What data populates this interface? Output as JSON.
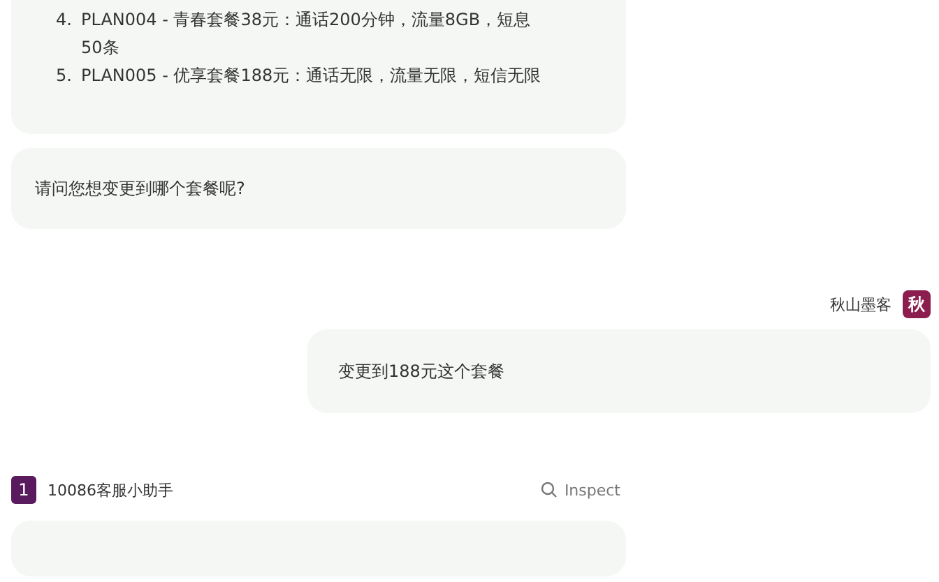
{
  "messages": [
    {
      "kind": "list",
      "items": [
        {
          "number": "4.",
          "text": "PLAN004 - 青春套餐38元：通话200分钟，流量8GB，短息50条"
        },
        {
          "number": "5.",
          "text": "PLAN005 - 优享套餐188元：通话无限，流量无限，短信无限"
        }
      ]
    },
    {
      "kind": "bot_text",
      "text": "请问您想变更到哪个套餐呢?"
    },
    {
      "kind": "user_text",
      "sender": "秋山墨客",
      "avatar": "秋",
      "text": "变更到188元这个套餐"
    },
    {
      "kind": "header",
      "badge": "1",
      "sender": "10086客服小助手",
      "action": "Inspect"
    },
    {
      "kind": "cut"
    }
  ]
}
